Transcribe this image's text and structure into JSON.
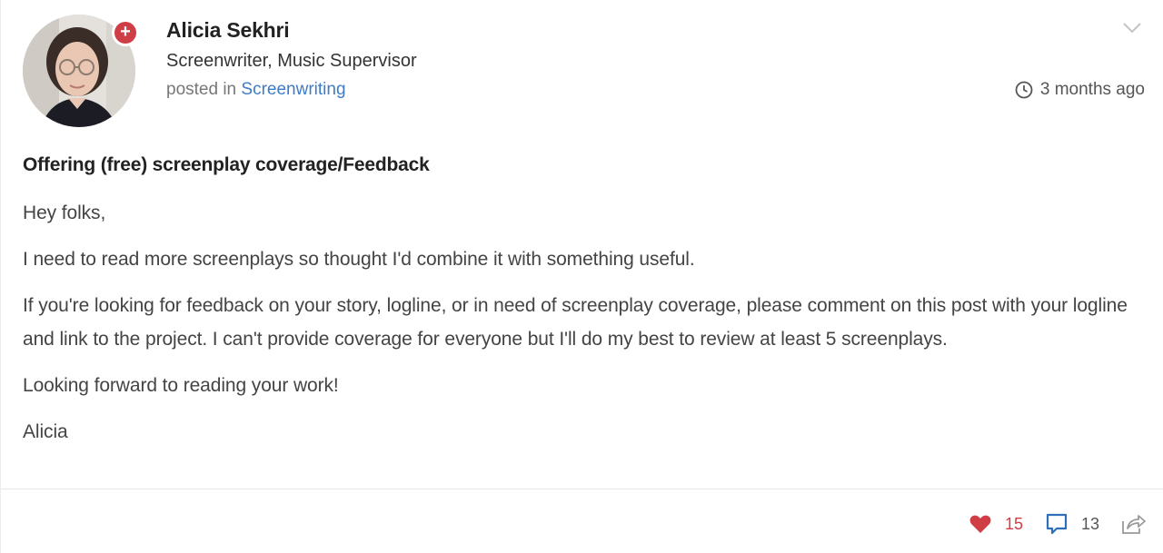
{
  "post": {
    "author": {
      "name": "Alicia Sekhri",
      "role": "Screenwriter, Music Supervisor",
      "posted_prefix": "posted in",
      "category": "Screenwriting",
      "badge_symbol": "+"
    },
    "timestamp": "3 months ago",
    "title": "Offering (free) screenplay coverage/Feedback",
    "body": [
      "Hey folks,",
      "I need to read more screenplays so thought I'd combine it with something useful.",
      "If you're looking for feedback on your story, logline, or in need of screenplay coverage, please comment on this post with your logline and link to the project. I can't provide coverage for everyone but I'll do my best to review at least 5 screenplays.",
      "Looking forward to reading your work!",
      "Alicia"
    ],
    "likes": "15",
    "comments": "13"
  },
  "icons": {
    "menu": "chevron-down-icon",
    "time": "clock-icon",
    "like": "heart-icon",
    "comment": "speech-bubble-icon",
    "share": "share-icon"
  },
  "colors": {
    "link": "#3d7cc9",
    "heart": "#cf3d45",
    "comment_icon": "#2f6fb9",
    "badge": "#cf3d45"
  }
}
